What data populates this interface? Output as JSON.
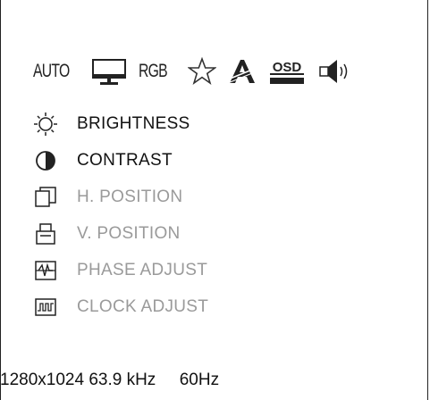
{
  "toolbar": {
    "auto_label": "AUTO",
    "display_icon": "monitor-icon",
    "rgb_label": "RGB",
    "favorite_icon": "star-icon",
    "language_icon": "language-icon",
    "osd_label": "OSD",
    "volume_icon": "speaker-icon"
  },
  "menu": {
    "items": [
      {
        "label": "BRIGHTNESS",
        "icon": "brightness-icon",
        "state": "active"
      },
      {
        "label": "CONTRAST",
        "icon": "contrast-icon",
        "state": "active"
      },
      {
        "label": "H. POSITION",
        "icon": "h-position-icon",
        "state": "inactive"
      },
      {
        "label": "V. POSITION",
        "icon": "v-position-icon",
        "state": "inactive"
      },
      {
        "label": "PHASE ADJUST",
        "icon": "phase-icon",
        "state": "inactive"
      },
      {
        "label": "CLOCK ADJUST",
        "icon": "clock-icon",
        "state": "inactive"
      }
    ]
  },
  "status": {
    "resolution": "1280x1024",
    "h_freq": "63.9 kHz",
    "v_freq": "60Hz"
  },
  "colors": {
    "active_text": "#111111",
    "inactive_text": "#9a9a9a",
    "background": "#ffffff"
  }
}
